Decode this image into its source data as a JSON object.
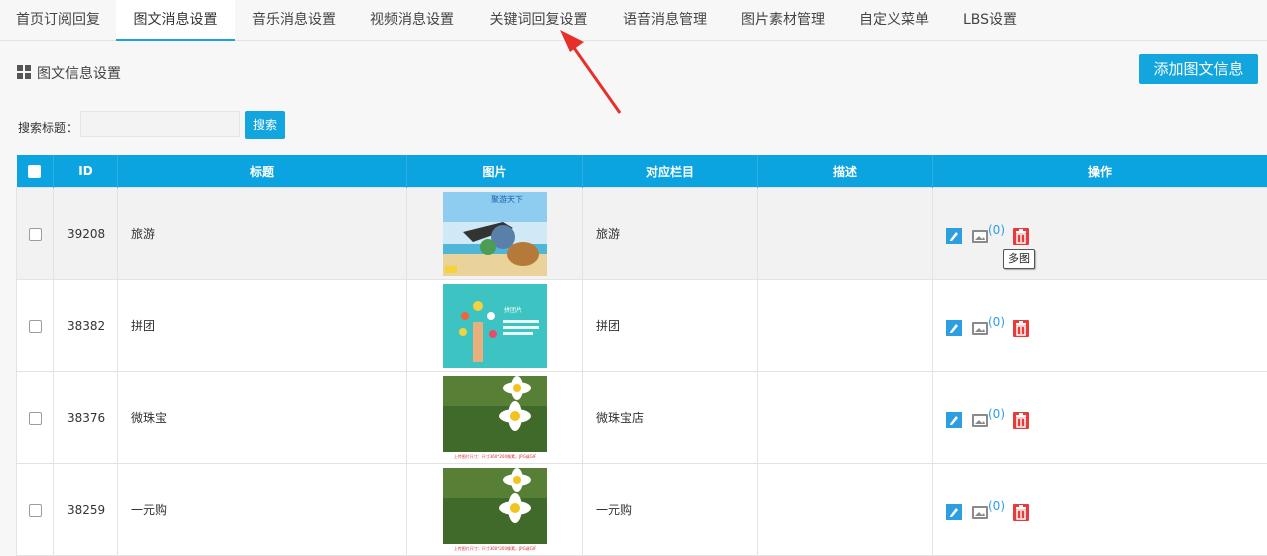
{
  "tabs": [
    "首页订阅回复",
    "图文消息设置",
    "音乐消息设置",
    "视频消息设置",
    "关键词回复设置",
    "语音消息管理",
    "图片素材管理",
    "自定义菜单",
    "LBS设置"
  ],
  "active_tab": "图文消息设置",
  "section": {
    "title": "图文信息设置",
    "add_button": "添加图文信息"
  },
  "search": {
    "label": "搜索标题：",
    "value": "",
    "button": "搜索"
  },
  "table": {
    "headers": [
      "ID",
      "标题",
      "图片",
      "对应栏目",
      "描述",
      "操作"
    ],
    "rows": [
      {
        "id": "39208",
        "title": "旅游",
        "category": "旅游",
        "description": "",
        "image_count": "(0)",
        "thumb_text": "聚游天下"
      },
      {
        "id": "38382",
        "title": "拼团",
        "category": "拼团",
        "description": "",
        "image_count": "(0)",
        "thumb_text": "拼团片"
      },
      {
        "id": "38376",
        "title": "微珠宝",
        "category": "微珠宝店",
        "description": "",
        "image_count": "(0)",
        "thumb_text": "上传图片尺寸：尺寸360*200像素，JPG或GIF"
      },
      {
        "id": "38259",
        "title": "一元购",
        "category": "一元购",
        "description": "",
        "image_count": "(0)",
        "thumb_text": "上传图片尺寸：尺寸360*200像素，JPG或GIF"
      }
    ]
  },
  "tooltip": "多图",
  "colors": {
    "accent": "#0ba4e0",
    "edit": "#2d9ee0",
    "delete": "#e93a3a",
    "arrow": "#e8302a"
  },
  "icons": {
    "section": "grid-icon",
    "edit": "pencil-icon",
    "images": "picture-icon",
    "delete": "trash-icon"
  }
}
